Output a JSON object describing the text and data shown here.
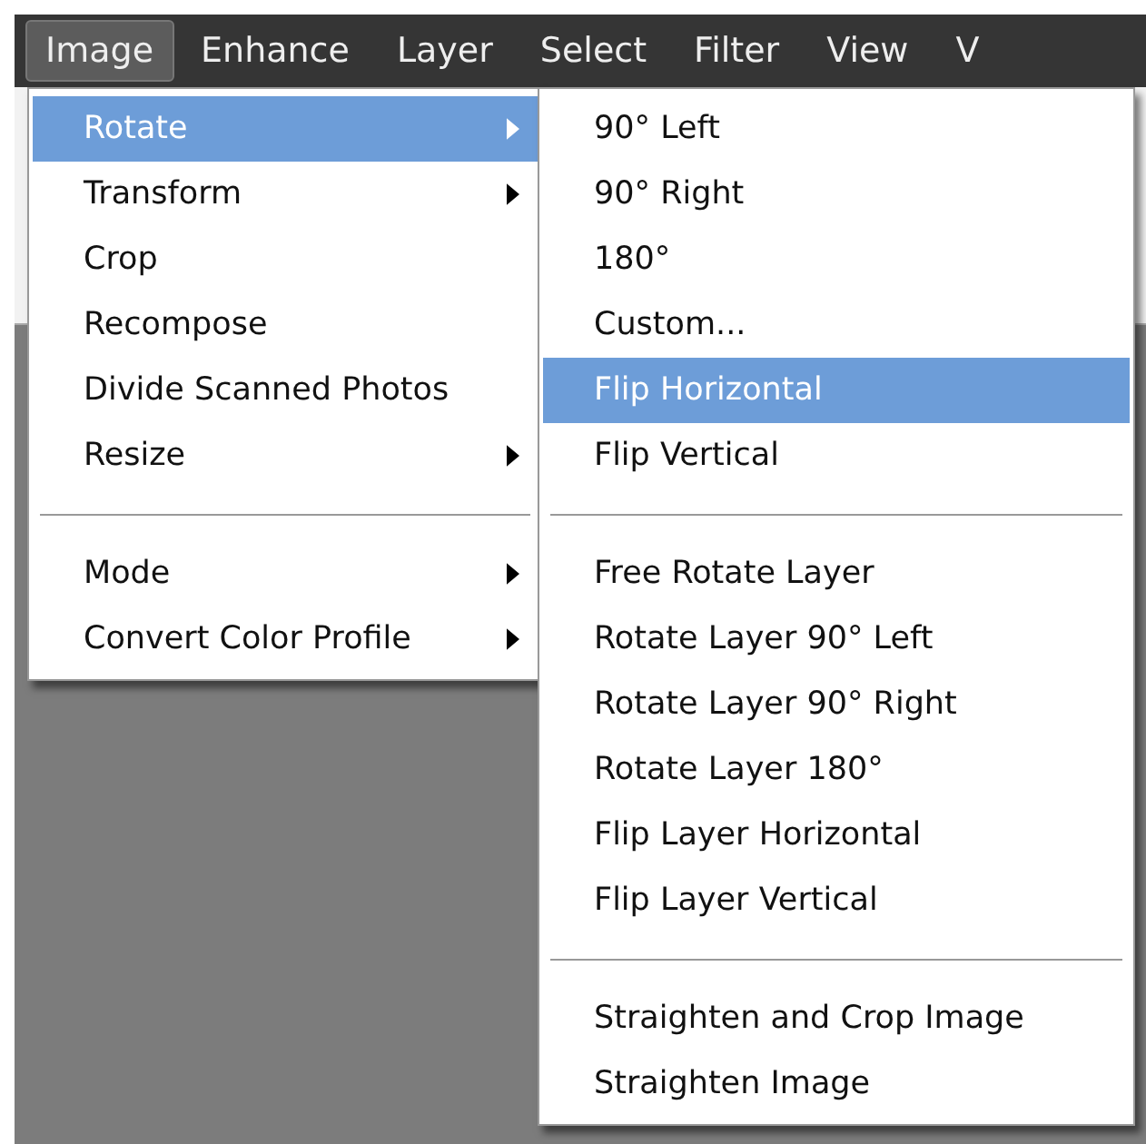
{
  "menubar": [
    {
      "label": "Image",
      "selected": true
    },
    {
      "label": "Enhance",
      "selected": false
    },
    {
      "label": "Layer",
      "selected": false
    },
    {
      "label": "Select",
      "selected": false
    },
    {
      "label": "Filter",
      "selected": false
    },
    {
      "label": "View",
      "selected": false
    },
    {
      "label": "V",
      "selected": false
    }
  ],
  "menu": [
    {
      "kind": "item",
      "label": "Rotate",
      "selected": true,
      "submenu": true
    },
    {
      "kind": "item",
      "label": "Transform",
      "selected": false,
      "submenu": true
    },
    {
      "kind": "item",
      "label": "Crop",
      "selected": false,
      "submenu": false
    },
    {
      "kind": "item",
      "label": "Recompose",
      "selected": false,
      "submenu": false
    },
    {
      "kind": "item",
      "label": "Divide Scanned Photos",
      "selected": false,
      "submenu": false
    },
    {
      "kind": "item",
      "label": "Resize",
      "selected": false,
      "submenu": true
    },
    {
      "kind": "separator"
    },
    {
      "kind": "item",
      "label": "Mode",
      "selected": false,
      "submenu": true
    },
    {
      "kind": "item",
      "label": "Convert Color Profile",
      "selected": false,
      "submenu": true
    }
  ],
  "submenu": [
    {
      "kind": "item",
      "label": "90° Left",
      "selected": false
    },
    {
      "kind": "item",
      "label": "90° Right",
      "selected": false
    },
    {
      "kind": "item",
      "label": "180°",
      "selected": false
    },
    {
      "kind": "item",
      "label": "Custom...",
      "selected": false
    },
    {
      "kind": "item",
      "label": "Flip Horizontal",
      "selected": true
    },
    {
      "kind": "item",
      "label": "Flip Vertical",
      "selected": false
    },
    {
      "kind": "separator"
    },
    {
      "kind": "item",
      "label": "Free Rotate Layer",
      "selected": false
    },
    {
      "kind": "item",
      "label": "Rotate Layer 90° Left",
      "selected": false
    },
    {
      "kind": "item",
      "label": "Rotate Layer 90° Right",
      "selected": false
    },
    {
      "kind": "item",
      "label": "Rotate Layer 180°",
      "selected": false
    },
    {
      "kind": "item",
      "label": "Flip Layer Horizontal",
      "selected": false
    },
    {
      "kind": "item",
      "label": "Flip Layer Vertical",
      "selected": false
    },
    {
      "kind": "separator"
    },
    {
      "kind": "item",
      "label": "Straighten and Crop Image",
      "selected": false
    },
    {
      "kind": "item",
      "label": "Straighten Image",
      "selected": false
    }
  ]
}
